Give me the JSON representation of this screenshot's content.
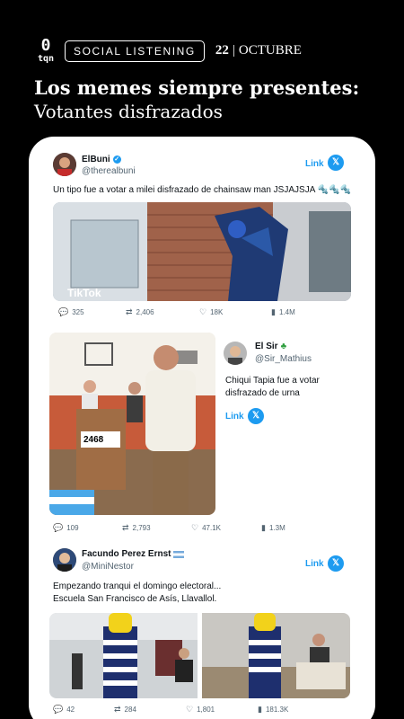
{
  "header": {
    "logo_top": "0",
    "logo_bottom": "tqn",
    "section": "SOCIAL LISTENING",
    "date_day": "22",
    "date_sep": "|",
    "date_month": "OCTUBRE"
  },
  "title": "Los memes siempre presentes:",
  "subtitle": "Votantes disfrazados",
  "tweets": [
    {
      "name": "ElBuni",
      "handle": "@therealbuni",
      "text": "Un tipo fue a votar a milei disfrazado de chainsaw man JSJAJSJA 🔩🔩🔩",
      "link": "Link",
      "media_label": "TikTok",
      "stats": {
        "replies": "325",
        "retweets": "2,406",
        "likes": "18K",
        "views": "1.4M"
      }
    },
    {
      "name": "El Sir",
      "handle": "@Sir_Mathius",
      "text": "Chiqui Tapia fue a votar disfrazado de urna",
      "link": "Link",
      "urn_number": "2468",
      "stats": {
        "replies": "109",
        "retweets": "2,793",
        "likes": "47.1K",
        "views": "1.3M"
      }
    },
    {
      "name": "Facundo Perez Ernst",
      "handle": "@MiniNestor",
      "text_line1": "Empezando tranqui el domingo electoral...",
      "text_line2": "Escuela San Francisco de Asís, Llavallol.",
      "link": "Link",
      "stats": {
        "replies": "42",
        "retweets": "284",
        "likes": "1,801",
        "views": "181.3K"
      }
    }
  ],
  "colors": {
    "accent": "#1d9bf0",
    "background": "#000000",
    "card": "#ffffff"
  },
  "icons": [
    "reply-icon",
    "retweet-icon",
    "like-icon",
    "views-icon",
    "x-logo-icon",
    "verified-icon"
  ]
}
